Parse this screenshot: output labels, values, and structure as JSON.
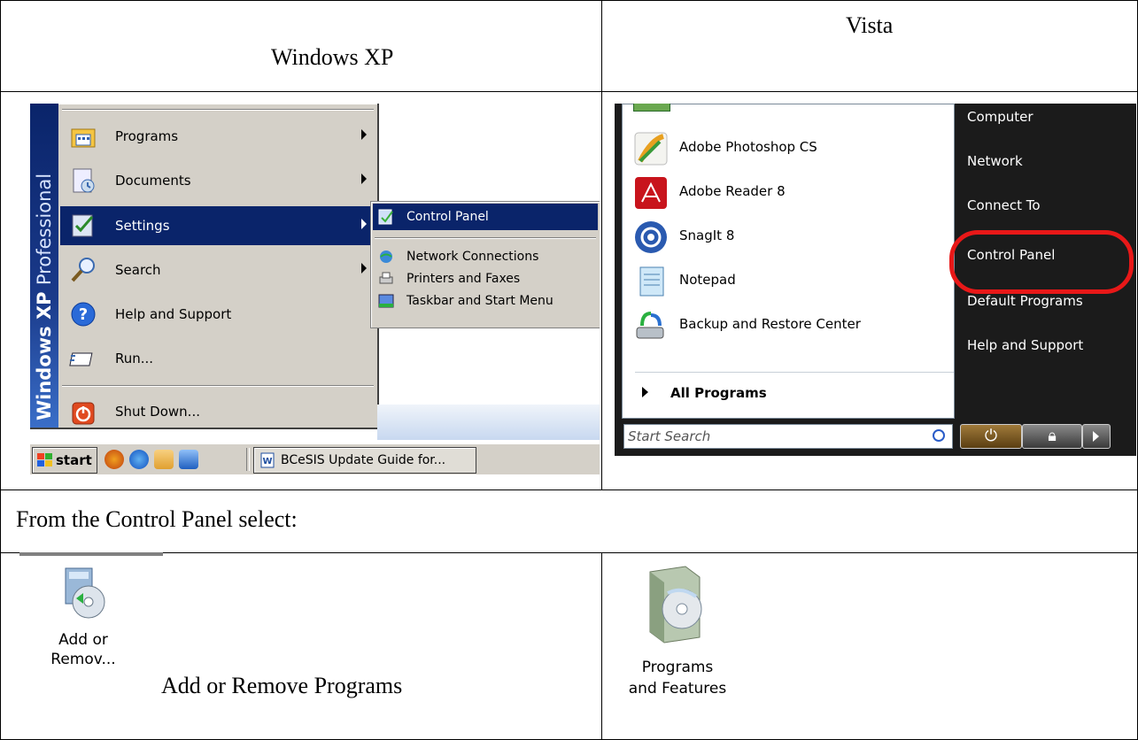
{
  "table": {
    "header_xp": "Windows XP",
    "header_vista": "Vista",
    "instruction": "From the Control Panel select:",
    "xp_caption": "Add or Remove Programs"
  },
  "xp": {
    "band_bold": "Windows XP",
    "band_light": "Professional",
    "menu": [
      {
        "label": "Programs",
        "icon": "programs-folder-icon",
        "has_arrow": true
      },
      {
        "label": "Documents",
        "icon": "documents-icon",
        "has_arrow": true
      },
      {
        "label": "Settings",
        "icon": "settings-icon",
        "has_arrow": true,
        "selected": true
      },
      {
        "label": "Search",
        "icon": "search-icon",
        "has_arrow": true
      },
      {
        "label": "Help and Support",
        "icon": "help-icon",
        "has_arrow": false
      },
      {
        "label": "Run...",
        "icon": "run-icon",
        "has_arrow": false
      },
      {
        "label": "Shut Down...",
        "icon": "shutdown-icon",
        "has_arrow": false
      }
    ],
    "submenu": [
      {
        "label": "Control Panel",
        "icon": "control-panel-icon",
        "selected": true
      },
      {
        "label": "Network Connections",
        "icon": "network-connections-icon"
      },
      {
        "label": "Printers and Faxes",
        "icon": "printers-icon"
      },
      {
        "label": "Taskbar and Start Menu",
        "icon": "taskbar-icon"
      }
    ],
    "start_label": "start",
    "taskbar_item": "BCeSIS Update Guide for..."
  },
  "vista": {
    "left_items": [
      {
        "label": "Adobe Photoshop CS",
        "icon": "photoshop-icon"
      },
      {
        "label": "Adobe Reader 8",
        "icon": "adobe-reader-icon"
      },
      {
        "label": "SnagIt 8",
        "icon": "snagit-icon"
      },
      {
        "label": "Notepad",
        "icon": "notepad-icon"
      },
      {
        "label": "Backup and Restore Center",
        "icon": "backup-icon"
      }
    ],
    "all_programs": "All Programs",
    "search_placeholder": "Start Search",
    "right_items": [
      "Computer",
      "Network",
      "Connect To",
      "Control Panel",
      "Default Programs",
      "Help and Support"
    ],
    "highlight_color": "#e81818"
  },
  "control_panel": {
    "xp_icon_label_1": "Add or",
    "xp_icon_label_2": "Remov...",
    "vista_icon_label_1": "Programs",
    "vista_icon_label_2": "and Features"
  }
}
